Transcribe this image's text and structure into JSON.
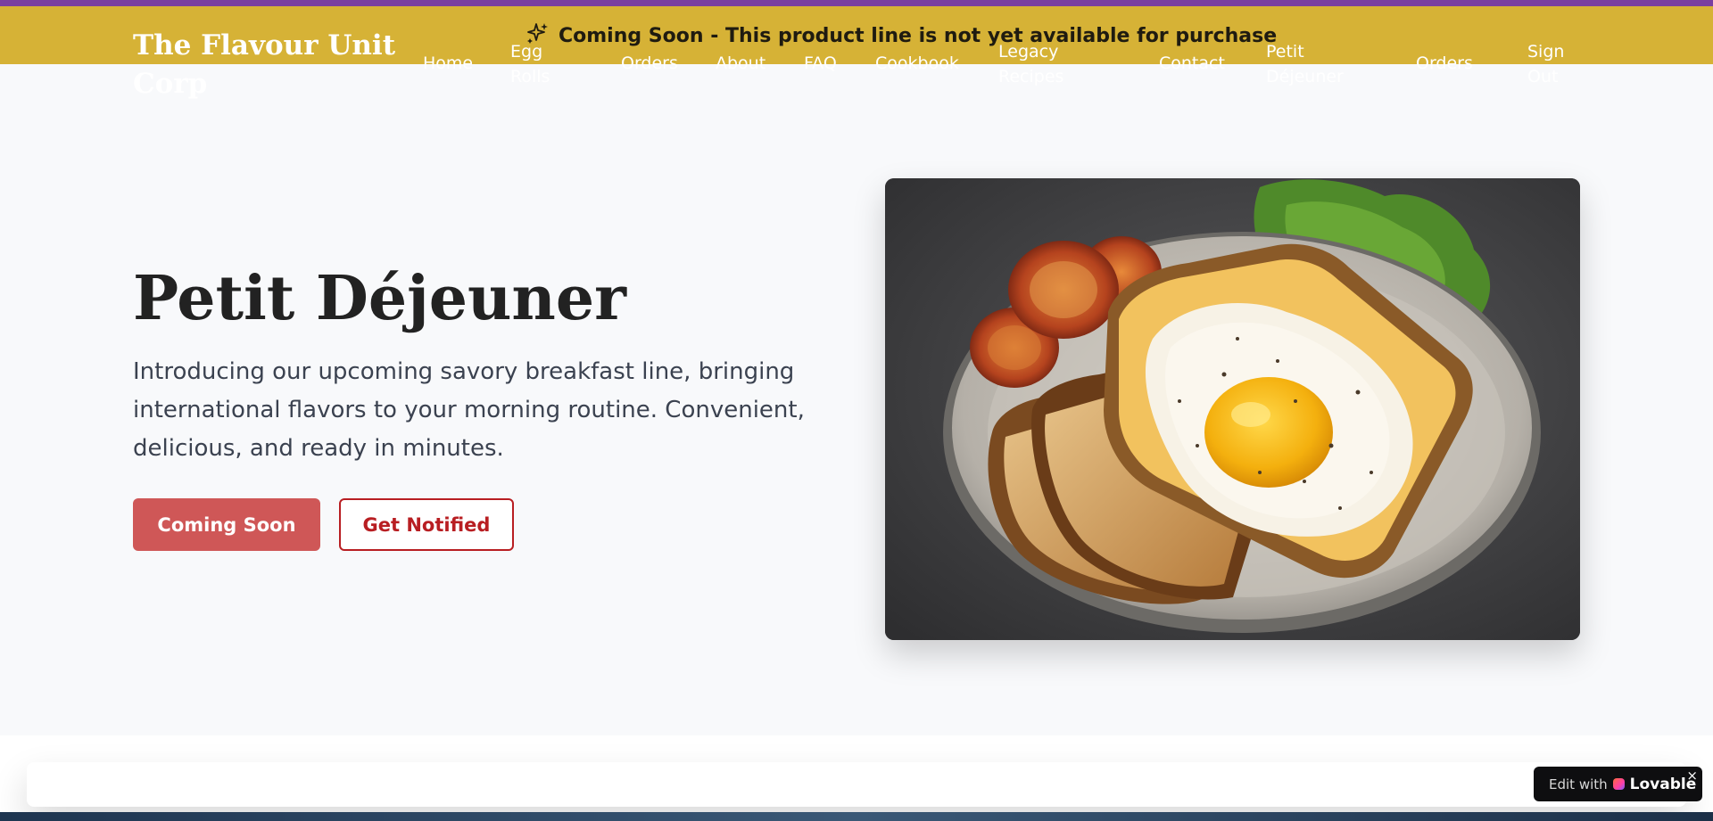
{
  "announcement": {
    "text": "Coming Soon - This product line is not yet available for purchase",
    "icon": "sparkles-icon"
  },
  "brand": {
    "name": "The Flavour Unit Corp"
  },
  "nav": {
    "items": [
      {
        "label": "Home"
      },
      {
        "label": "Egg Rolls"
      },
      {
        "label": "Orders"
      },
      {
        "label": "About"
      },
      {
        "label": "FAQ"
      },
      {
        "label": "Cookbook"
      },
      {
        "label": "Legacy Recipes"
      },
      {
        "label": "Contact"
      },
      {
        "label": "Petit Déjeuner"
      },
      {
        "label": "Orders"
      },
      {
        "label": "Sign Out"
      }
    ]
  },
  "hero": {
    "title": "Petit Déjeuner",
    "description": "Introducing our upcoming savory breakfast line, bringing international flavors to your morning routine. Convenient, delicious, and ready in minutes.",
    "primary_button": "Coming Soon",
    "secondary_button": "Get Notified",
    "image_subject": "fried egg on toast with grilled tomatoes and lettuce"
  },
  "badge": {
    "prefix": "Edit with",
    "name": "Lovable",
    "close": "×"
  },
  "colors": {
    "header": "#d6b236",
    "top_strip": "#7a3fa0",
    "primary_button": "#cf5757",
    "outline_button": "#b81e22",
    "page_background": "#f8f9fb"
  }
}
